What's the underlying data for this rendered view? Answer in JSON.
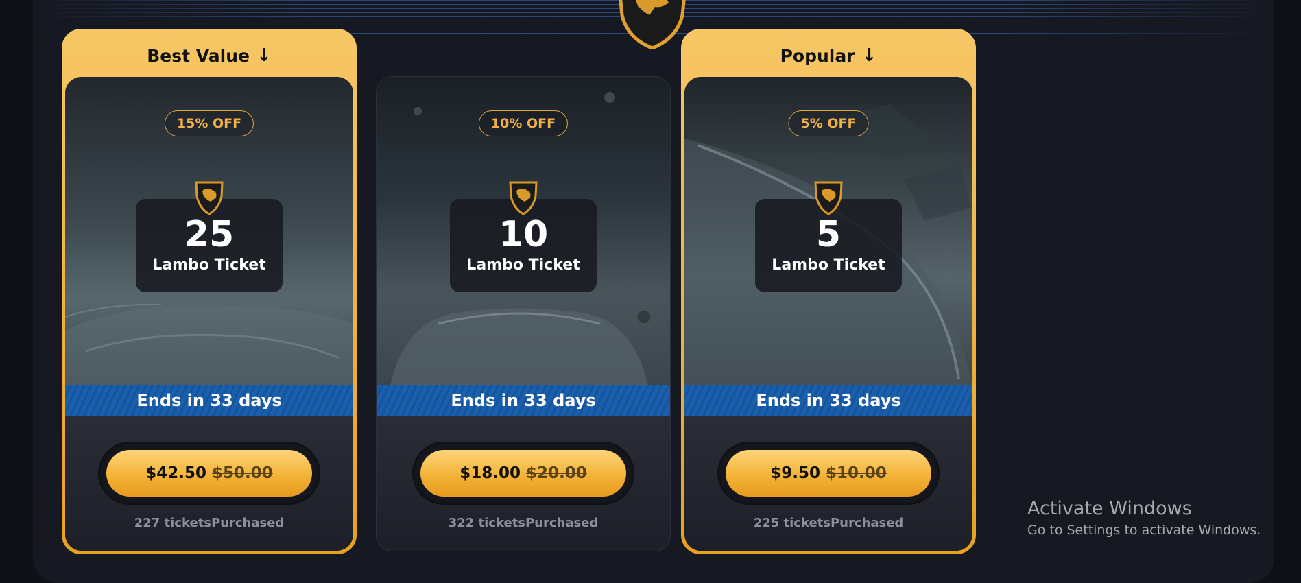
{
  "colors": {
    "background": "#0e1018",
    "panel": "#161921",
    "gold": "#f3b338",
    "ends_banner": "#1a5fae",
    "badge_text": "#f0b14a"
  },
  "icons": {
    "top_emblem": "lamborghini-shield-icon",
    "card_emblem": "lamborghini-shield-icon",
    "header_arrow": "arrow-down-icon"
  },
  "cards": [
    {
      "header": "Best Value",
      "discount": "15% OFF",
      "count": "25",
      "label": "Lambo Ticket",
      "ends": "Ends in 33 days",
      "price": "$42.50",
      "old_price": "$50.00",
      "purchased": "227 ticketsPurchased"
    },
    {
      "header": "",
      "discount": "10% OFF",
      "count": "10",
      "label": "Lambo Ticket",
      "ends": "Ends in 33 days",
      "price": "$18.00",
      "old_price": "$20.00",
      "purchased": "322 ticketsPurchased"
    },
    {
      "header": "Popular",
      "discount": "5% OFF",
      "count": "5",
      "label": "Lambo Ticket",
      "ends": "Ends in 33 days",
      "price": "$9.50",
      "old_price": "$10.00",
      "purchased": "225 ticketsPurchased"
    }
  ],
  "watermark": {
    "title": "Activate Windows",
    "subtitle": "Go to Settings to activate Windows."
  }
}
